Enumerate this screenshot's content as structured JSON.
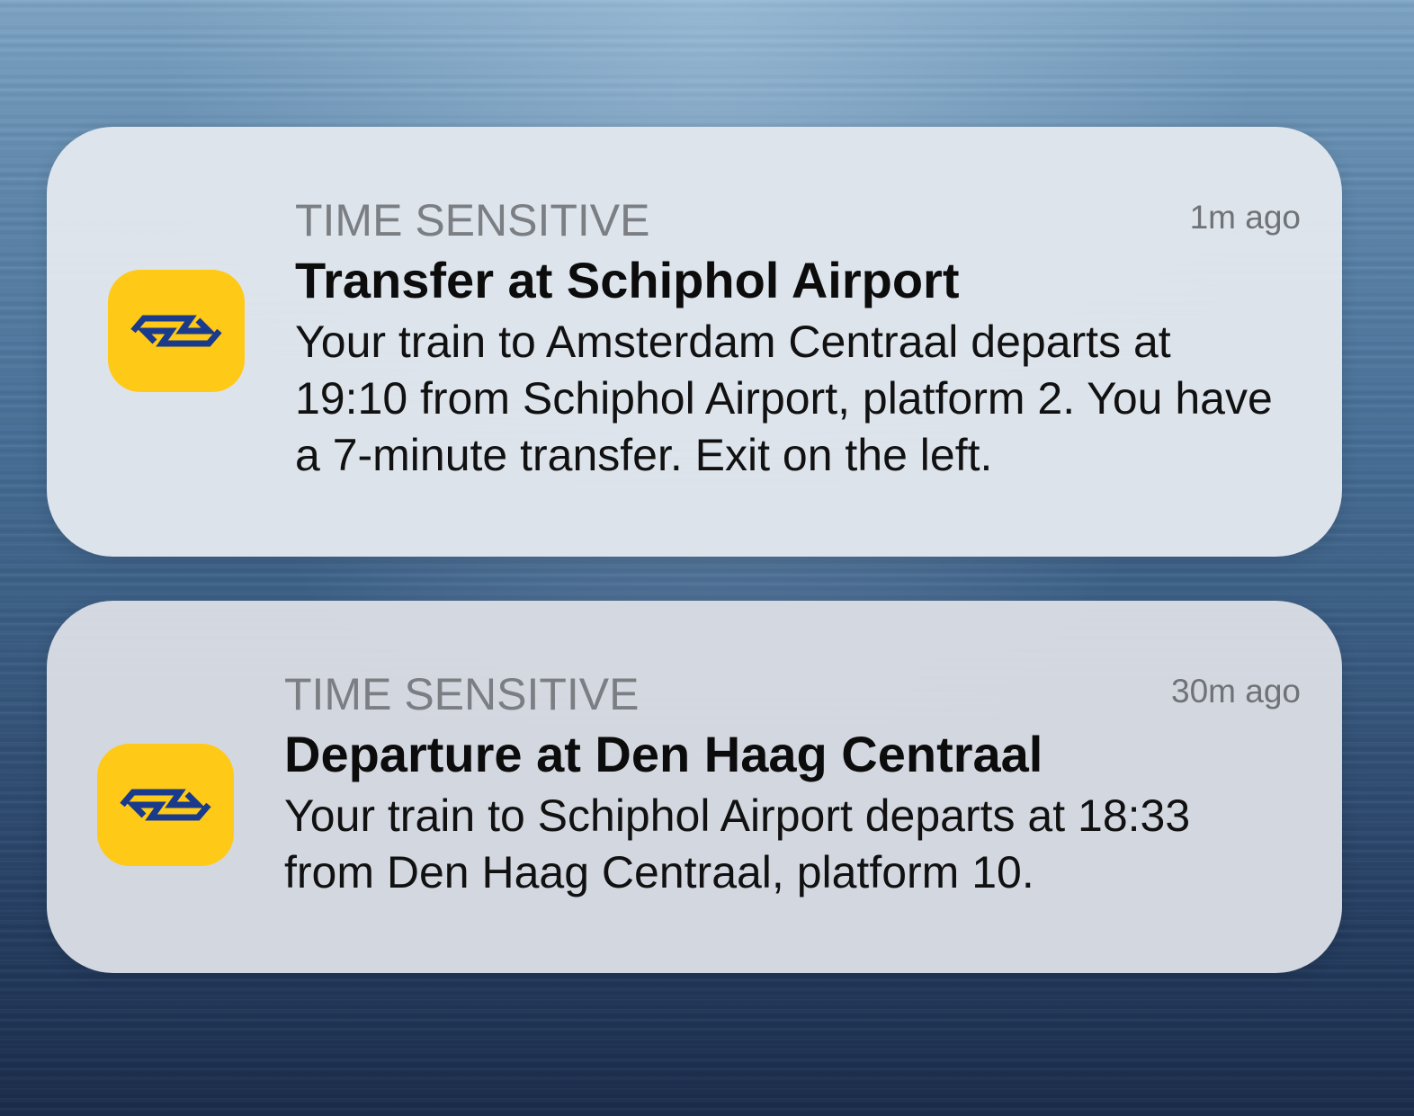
{
  "notifications": [
    {
      "app_icon": "ns-logo-icon",
      "category": "TIME SENSITIVE",
      "time": "1m ago",
      "title": "Transfer at Schiphol Airport",
      "body": "Your train to Amsterdam Centraal departs at 19:10 from Schiphol Airport, platform 2. You have a 7-minute transfer. Exit on the left."
    },
    {
      "app_icon": "ns-logo-icon",
      "category": "TIME SENSITIVE",
      "time": "30m ago",
      "title": "Departure at Den Haag Centraal",
      "body": "Your train to Schiphol Airport departs at 18:33 from Den Haag Centraal, platform 10."
    }
  ],
  "colors": {
    "icon_background": "#ffc917",
    "icon_mark": "#1a3a8c"
  }
}
